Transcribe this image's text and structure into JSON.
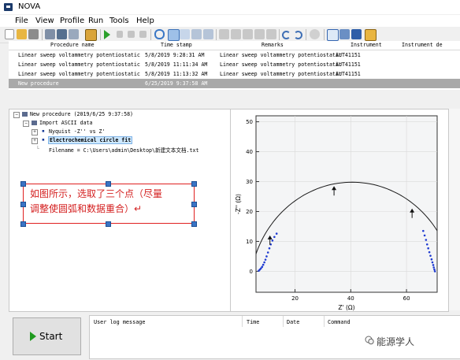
{
  "window": {
    "title": "NOVA"
  },
  "menu": [
    "File",
    "View",
    "Profile",
    "Run",
    "Tools",
    "Help"
  ],
  "toolbar_icons": [
    "new-icon",
    "open-icon",
    "print-icon",
    "cut-icon",
    "copy-icon",
    "paste-icon",
    "import-icon",
    "play-icon",
    "pause-icon",
    "stop-icon",
    "skip-icon",
    "help-icon",
    "grid-icon",
    "grid2-icon",
    "grid3-icon",
    "grid4-icon",
    "link-icon",
    "link2-icon",
    "chart-icon",
    "chart2-icon",
    "chart3-icon",
    "undo-icon",
    "redo-icon",
    "options-icon",
    "window-icon",
    "plot-icon",
    "table-icon",
    "export-icon"
  ],
  "grid": {
    "columns": [
      "Procedure name",
      "Time stamp",
      "Remarks",
      "Instrument",
      "Instrument de"
    ],
    "rows": [
      [
        "Linear sweep voltammetry potentiostatic",
        "5/8/2019 9:28:31 AM",
        "Linear sweep voltammetry potentiostatic",
        "AUT41151",
        ""
      ],
      [
        "Linear sweep voltammetry potentiostatic",
        "5/8/2019 11:11:34 AM",
        "Linear sweep voltammetry potentiostatic",
        "AUT41151",
        ""
      ],
      [
        "Linear sweep voltammetry potentiostatic",
        "5/8/2019 11:13:32 AM",
        "Linear sweep voltammetry potentiostatic",
        "AUT41151",
        ""
      ],
      [
        "New procedure",
        "6/25/2019 9:37:58 AM",
        "",
        "",
        ""
      ]
    ]
  },
  "tree": {
    "root": "New procedure (2019/6/25 9:37:58)",
    "import": "Import ASCII data",
    "nyquist": "Nyquist -Z'' vs Z'",
    "circle_fit": "Electrochemical circle fit",
    "filename": "Filename = C:\\Users\\admin\\Desktop\\新建文本文档.txt"
  },
  "callout": {
    "line1": "如图所示，选取了三个点（尽量",
    "line2": "调整使圆弧和数据重合）↵"
  },
  "chart_data": {
    "type": "scatter",
    "xlabel": "Z' (Ω)",
    "ylabel": "-Z'' (Ω)",
    "xlim": [
      6,
      71
    ],
    "ylim": [
      -7,
      52
    ],
    "xticks": [
      20,
      40,
      60
    ],
    "yticks": [
      0,
      10,
      20,
      30,
      40,
      50
    ],
    "tick_labels_x": [
      "20",
      "40",
      "60"
    ],
    "tick_labels_y": [
      "0",
      "10",
      "20",
      "30",
      "40",
      "50"
    ],
    "fit_circle": {
      "center_x": 40.5,
      "center_y": -7.0,
      "radius": 36.8
    },
    "selected_points": [
      [
        11.0,
        12.0
      ],
      [
        34.0,
        28.5
      ],
      [
        62.0,
        21.0
      ]
    ],
    "series": [
      {
        "x": [
          7.0,
          7.4,
          7.8,
          8.2,
          8.6,
          9.0,
          9.4,
          9.8,
          10.3,
          10.8,
          11.3,
          11.9,
          12.6,
          13.4
        ],
        "y": [
          0.2,
          0.6,
          1.0,
          1.5,
          2.2,
          3.0,
          3.9,
          5.0,
          6.3,
          7.7,
          9.0,
          10.3,
          11.5,
          12.6
        ]
      },
      {
        "x": [
          66.0,
          66.5,
          67.0,
          67.4,
          67.8,
          68.2,
          68.6,
          69.0,
          69.3,
          69.6,
          69.8,
          70.0,
          70.2
        ],
        "y": [
          13.5,
          12.0,
          10.5,
          9.0,
          7.7,
          6.4,
          5.2,
          4.0,
          3.0,
          2.1,
          1.3,
          0.6,
          0.0
        ]
      }
    ]
  },
  "bottom": {
    "start_label": "Start",
    "log_columns": [
      "User log message",
      "Time",
      "Date",
      "Command"
    ]
  },
  "watermark": "能源学人"
}
